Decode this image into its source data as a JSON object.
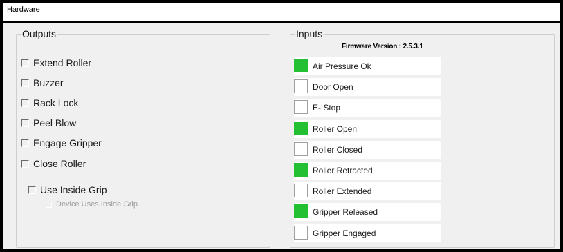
{
  "window": {
    "title": "Hardware"
  },
  "outputs": {
    "legend": "Outputs",
    "items": [
      {
        "label": "Extend Roller",
        "checked": false
      },
      {
        "label": "Buzzer",
        "checked": false
      },
      {
        "label": "Rack Lock",
        "checked": false
      },
      {
        "label": "Peel Blow",
        "checked": false
      },
      {
        "label": "Engage Gripper",
        "checked": false
      },
      {
        "label": "Close Roller",
        "checked": false
      }
    ],
    "inside_grip": {
      "label": "Use Inside Grip",
      "checked": false
    },
    "device_inside_grip": {
      "label": "Device Uses Inside Grip",
      "checked": false,
      "enabled": false
    }
  },
  "inputs": {
    "legend": "Inputs",
    "firmware_version": "Firmware Version : 2.5.3.1",
    "on_color": "#22c032",
    "items": [
      {
        "label": "Air Pressure Ok",
        "active": true
      },
      {
        "label": "Door Open",
        "active": false
      },
      {
        "label": "E- Stop",
        "active": false
      },
      {
        "label": "Roller Open",
        "active": true
      },
      {
        "label": "Roller Closed",
        "active": false
      },
      {
        "label": "Roller Retracted",
        "active": true
      },
      {
        "label": "Roller Extended",
        "active": false
      },
      {
        "label": "Gripper Released",
        "active": true
      },
      {
        "label": "Gripper Engaged",
        "active": false
      }
    ]
  }
}
